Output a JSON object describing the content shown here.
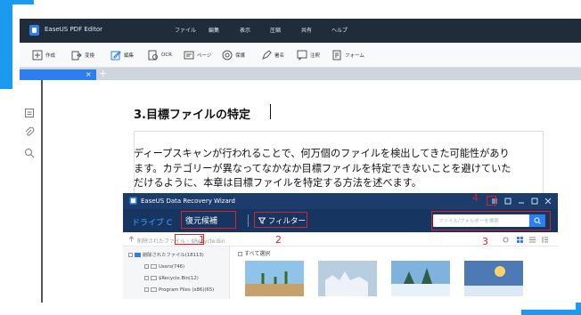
{
  "app": {
    "title": "EaseUS PDF Editor"
  },
  "menu": [
    "ファイル",
    "編集",
    "表示",
    "圧縮",
    "共有",
    "ヘルプ"
  ],
  "toolbar": [
    {
      "label": "作成",
      "icon": "create-icon"
    },
    {
      "label": "変換",
      "icon": "convert-icon"
    },
    {
      "label": "編集",
      "icon": "edit-icon"
    },
    {
      "label": "OCR",
      "icon": "ocr-icon"
    },
    {
      "label": "ページ",
      "icon": "page-icon"
    },
    {
      "label": "保護",
      "icon": "protect-icon"
    },
    {
      "label": "署名",
      "icon": "sign-icon"
    },
    {
      "label": "注釈",
      "icon": "comment-icon"
    },
    {
      "label": "フォーム",
      "icon": "form-icon"
    }
  ],
  "tabs": {
    "close": "×",
    "add": "+"
  },
  "document": {
    "heading": "3.目標ファイルの特定",
    "paragraph": [
      "ディープスキャンが行われることで、何万個のファイルを検出してきた可能性があり",
      "ます。カテゴリーが異なってなかなか目標ファイルを特定できないことを避けていた",
      "だけるように、本章は目標ファイルを特定する方法を述べます。"
    ]
  },
  "recovery": {
    "title": "EaseUS Data Recovery Wizard",
    "drive": "ドライブ C",
    "recover_tab": "復元候補",
    "filter": "フィルター",
    "search_placeholder": "ファイル/フォルダーを検索",
    "breadcrumb": "削除されたファイル › $Recycle.Bin",
    "select_all": "すべて選択",
    "tree": [
      {
        "label": "削除されたファイル(18113)"
      },
      {
        "label": "Users(746)"
      },
      {
        "label": "$Recycle.Bin(12)"
      },
      {
        "label": "Program Files (x86)(65)"
      }
    ]
  },
  "annotations": [
    "1",
    "2",
    "3",
    "4"
  ],
  "colors": {
    "accent": "#1a9bf0",
    "titlebar": "#212c3b",
    "recovery_title": "#1c3d6c",
    "recovery_nav": "#163561",
    "highlight": "#e02020"
  }
}
